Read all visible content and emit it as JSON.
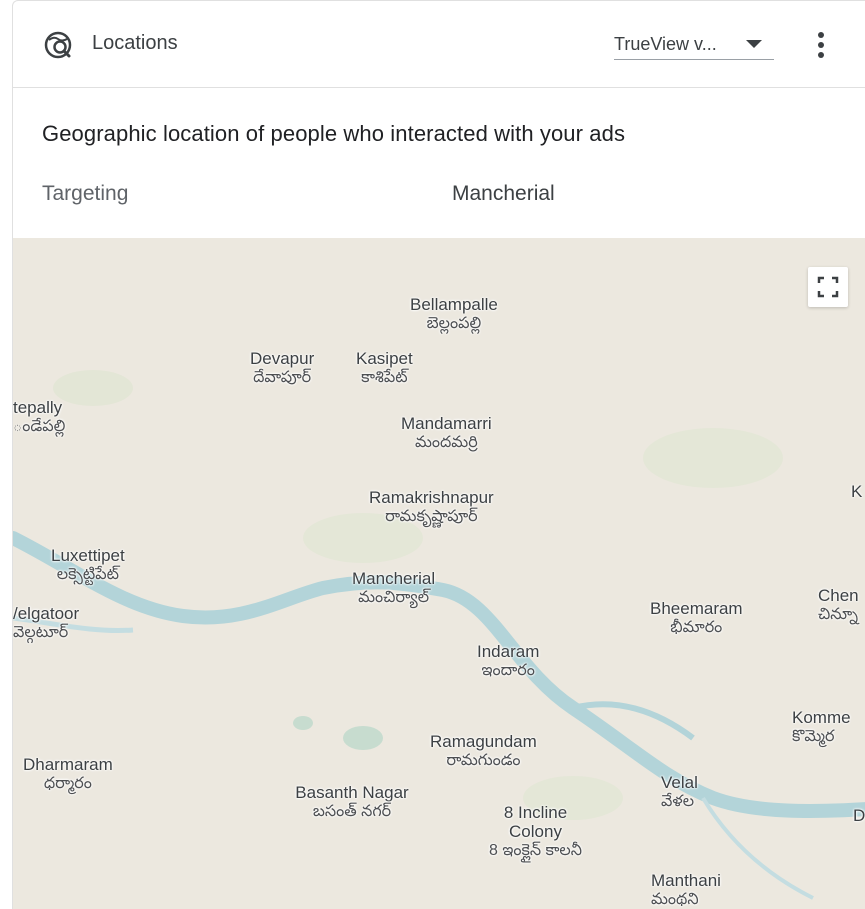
{
  "header": {
    "title": "Locations",
    "icon": "location-search-icon",
    "dropdown_value": "TrueView v...",
    "more_icon": "more-vert-icon"
  },
  "content": {
    "subtitle": "Geographic location of people who interacted with your ads",
    "targeting_label": "Targeting",
    "targeting_value": "Mancherial"
  },
  "map": {
    "fullscreen_icon": "fullscreen-icon",
    "colors": {
      "land": "#ece8df",
      "river": "#b3d4d9",
      "green": "#cfe3c6"
    },
    "places": [
      {
        "name": "Bellampalle",
        "alt": "బెల్లంపల్లి"
      },
      {
        "name": "Devapur",
        "alt": "దేవాపూర్"
      },
      {
        "name": "Kasipet",
        "alt": "కాశిపేట్"
      },
      {
        "name": "tepally",
        "alt": "ండేపల్లి"
      },
      {
        "name": "Mandamarri",
        "alt": "మందమర్రి"
      },
      {
        "name": "Ramakrishnapur",
        "alt": "రామకృష్ణాపూర్"
      },
      {
        "name": "K",
        "alt": ""
      },
      {
        "name": "Luxettipet",
        "alt": "లక్సెట్టిపేట్"
      },
      {
        "name": "Mancherial",
        "alt": "మంచిర్యాల్"
      },
      {
        "name": "Bheemaram",
        "alt": "భీమారం"
      },
      {
        "name": "Chen",
        "alt": "చిన్నూ"
      },
      {
        "name": "/elgatoor",
        "alt": "వెల్గటూర్"
      },
      {
        "name": "Indaram",
        "alt": "ఇందారం"
      },
      {
        "name": "Komme",
        "alt": "కొమ్మెర"
      },
      {
        "name": "Ramagundam",
        "alt": "రామగుండం"
      },
      {
        "name": "Dharmaram",
        "alt": "ధర్మారం"
      },
      {
        "name": "Basanth Nagar",
        "alt": "బసంత్ నగర్"
      },
      {
        "name": "Velal",
        "alt": "వేళల"
      },
      {
        "name": "8 Incline Colony",
        "alt": "8 ఇంక్లైన్ కాలనీ"
      },
      {
        "name": "D",
        "alt": ""
      },
      {
        "name": "Manthani",
        "alt": "మంథని"
      }
    ]
  }
}
